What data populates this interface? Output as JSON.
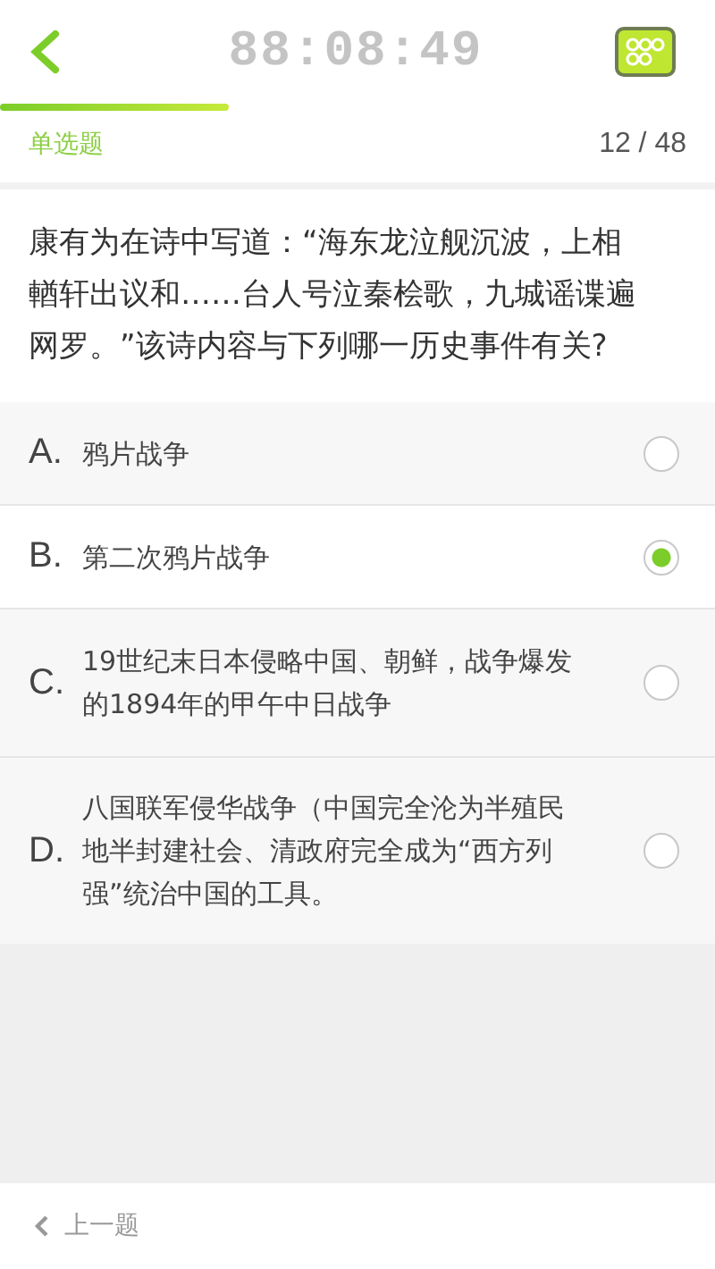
{
  "header": {
    "timer": "88:08:49"
  },
  "progress": {
    "level": 0.32
  },
  "question_type": "单选题",
  "counter": "12 / 48",
  "question": "康有为在诗中写道：“海东龙泣舰沉波，上相輶轩出议和……台人号泣秦桧歌，九城谣谍遍网罗。”该诗内容与下列哪一历史事件有关?",
  "options": [
    {
      "letter": "A.",
      "text": "鸦片战争",
      "selected": false
    },
    {
      "letter": "B.",
      "text": "第二次鸦片战争",
      "selected": true
    },
    {
      "letter": "C.",
      "text": "19世纪末日本侵略中国、朝鲜，战争爆发的1894年的甲午中日战争",
      "selected": false
    },
    {
      "letter": "D.",
      "text": "八国联军侵华战争（中国完全沦为半殖民地半封建社会、清政府完全成为“西方列强”统治中国的工具。",
      "selected": false
    }
  ],
  "footer": {
    "prev": "上一题"
  }
}
